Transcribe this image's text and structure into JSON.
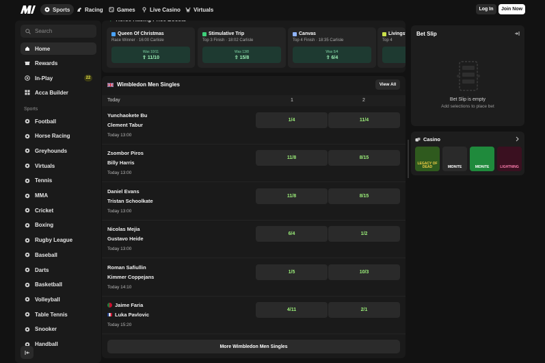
{
  "nav": {
    "items": [
      {
        "label": "Sports",
        "icon": "football-icon"
      },
      {
        "label": "Racing",
        "icon": "horse-icon"
      },
      {
        "label": "Games",
        "icon": "dice-icon"
      },
      {
        "label": "Live Casino",
        "icon": "live-icon"
      },
      {
        "label": "Virtuals",
        "icon": "virtuals-icon"
      }
    ],
    "login_label": "Log In",
    "join_label": "Join Now"
  },
  "sidebar": {
    "search_placeholder": "Search",
    "top_items": [
      {
        "label": "Home"
      },
      {
        "label": "Rewards"
      },
      {
        "label": "In-Play",
        "badge": "22"
      },
      {
        "label": "Acca Builder"
      }
    ],
    "sports_header": "Sports",
    "sports": [
      {
        "label": "Football"
      },
      {
        "label": "Horse Racing"
      },
      {
        "label": "Greyhounds"
      },
      {
        "label": "Virtuals"
      },
      {
        "label": "Tennis"
      },
      {
        "label": "MMA"
      },
      {
        "label": "Cricket"
      },
      {
        "label": "Boxing"
      },
      {
        "label": "Rugby League"
      },
      {
        "label": "Baseball"
      },
      {
        "label": "Darts"
      },
      {
        "label": "Basketball"
      },
      {
        "label": "Volleyball"
      },
      {
        "label": "Table Tennis"
      },
      {
        "label": "Snooker"
      },
      {
        "label": "Handball"
      }
    ]
  },
  "boosts": {
    "header": "Horse Racing Price Boosts",
    "cards": [
      {
        "title": "Queen Of Christmas",
        "sub": "Race Winner · 16:00 Carlisle",
        "was": "Was 10/11",
        "now": "11/10"
      },
      {
        "title": "Stimulative Trip",
        "sub": "Top 3 Finish · 18:02 Carlisle",
        "was": "Was 13/8",
        "now": "15/8"
      },
      {
        "title": "Canvas",
        "sub": "Top 4 Finish · 18:35 Carlisle",
        "was": "Was 5/4",
        "now": "6/4"
      },
      {
        "title": "Livingst",
        "sub": "Top 4",
        "was": "Was",
        "now": "1"
      }
    ]
  },
  "market": {
    "title": "Wimbledon Men Singles",
    "view_all": "View All",
    "col_today": "Today",
    "col_1": "1",
    "col_2": "2",
    "matches": [
      {
        "p1": "Yunchaokete Bu",
        "p2": "Clement Tabur",
        "time": "Today 13:00",
        "o1": "1/4",
        "o2": "11/4"
      },
      {
        "p1": "Zsombor Piros",
        "p2": "Billy Harris",
        "time": "Today 13:00",
        "o1": "11/8",
        "o2": "8/15"
      },
      {
        "p1": "Daniel Evans",
        "p2": "Tristan Schoolkate",
        "time": "Today 13:00",
        "o1": "11/8",
        "o2": "8/15"
      },
      {
        "p1": "Nicolas Mejia",
        "p2": "Gustavo Heide",
        "time": "Today 13:00",
        "o1": "6/4",
        "o2": "1/2"
      },
      {
        "p1": "Roman Safiullin",
        "p2": "Kimmer Coppejans",
        "time": "Today 14:10",
        "o1": "1/5",
        "o2": "10/3"
      },
      {
        "p1": "Jaime Faria",
        "p2": "Luka Pavlovic",
        "time": "Today 15:20",
        "o1": "4/11",
        "o2": "2/1"
      }
    ],
    "more_label": "More Wimbledon Men Singles"
  },
  "betslip": {
    "title": "Bet Slip",
    "empty_title": "Bet Slip is empty",
    "empty_sub": "Add selections to place bet"
  },
  "casino": {
    "title": "Casino",
    "games": [
      {
        "label": "LEGACY OF DEAD",
        "color": "#2f5a1e"
      },
      {
        "label": "MIDNITE",
        "color": "#2a2a2a"
      },
      {
        "label": "MIDNITE",
        "color": "#1f8a3c"
      },
      {
        "label": "LIGHTNING",
        "color": "#3a1020"
      }
    ]
  },
  "colors": {
    "accent_green": "#9cf07a",
    "boost_green": "#1e3a31",
    "badge_yellow": "#e4e04a"
  }
}
